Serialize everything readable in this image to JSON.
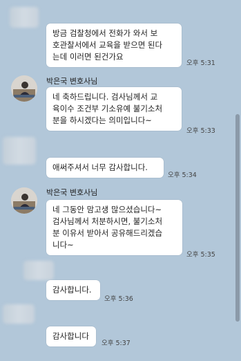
{
  "messages": [
    {
      "text": "방금 검찰청에서 전화가 와서 보\n호관찰서에서 교육을 받으면 된다\n는데 이러면 된건가요",
      "time": "오후 5:31"
    },
    {
      "sender": "박은국 변호사님",
      "text": "네 축하드립니다. 검사님께서 교\n육이수 조건부 기소유예 불기소처\n분을 하시겠다는 의미입니다~",
      "time": "오후 5:33"
    },
    {
      "text": "애써주셔서 너무 감사합니다.",
      "time": "오후 5:34"
    },
    {
      "sender": "박은국 변호사님",
      "text": "네 그동안 맘고생 많으셨습니다~\n검사님께서 처분하시면, 불기소처\n분 이유서 받아서 공유해드리겠습\n니다~",
      "time": "오후 5:35"
    },
    {
      "text": "감사합니다.",
      "time": "오후 5:36"
    },
    {
      "text": "감사합니다",
      "time": "오후 5:37"
    }
  ],
  "colors": {
    "background": "#b2c7d9",
    "bubble": "#ffffff"
  }
}
